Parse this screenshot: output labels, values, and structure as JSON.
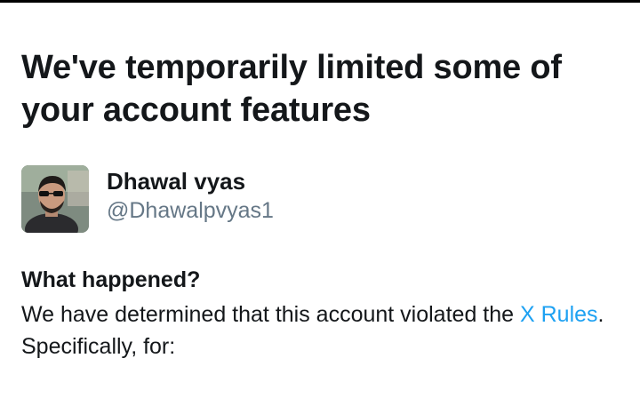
{
  "page": {
    "headline": "We've temporarily limited some of your account features"
  },
  "account": {
    "display_name": "Dhawal vyas",
    "handle": "@Dhawalpvyas1",
    "avatar_icon": "profile-photo"
  },
  "notice": {
    "title": "What happened?",
    "body_prefix": "We have determined that this account violated the ",
    "rules_link": "X Rules",
    "body_suffix": ". Specifically, for:"
  },
  "colors": {
    "text": "#14171a",
    "secondary_text": "#657786",
    "link": "#1da1f2"
  }
}
